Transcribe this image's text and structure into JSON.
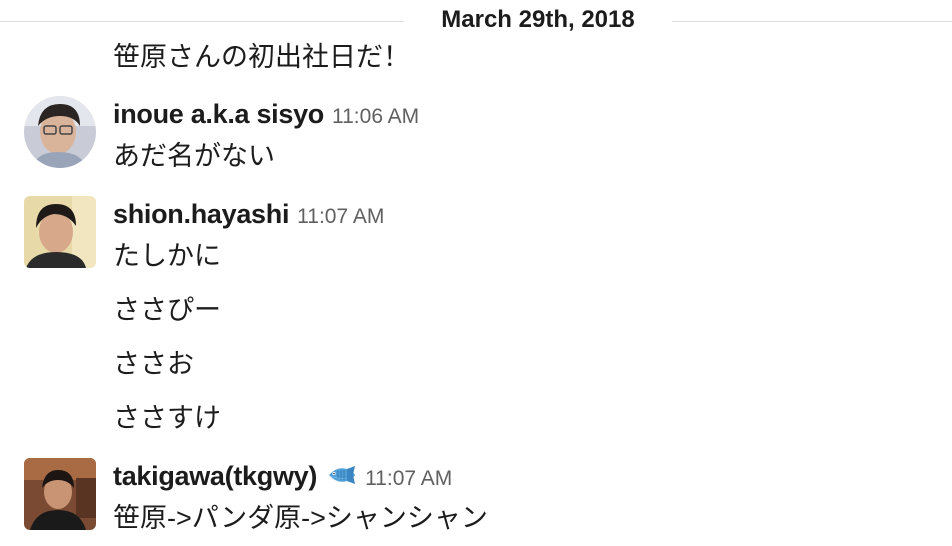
{
  "divider": {
    "date": "March 29th, 2018"
  },
  "messages": [
    {
      "username": "",
      "time": "",
      "lines": [
        "笹原さんの初出社日だ！"
      ]
    },
    {
      "username": "inoue a.k.a sisyo",
      "time": "11:06 AM",
      "avatar": "user-avatar-inoue",
      "lines": [
        "あだ名がない"
      ]
    },
    {
      "username": "shion.hayashi",
      "time": "11:07 AM",
      "avatar": "user-avatar-shion",
      "lines": [
        "たしかに",
        "ささぴー",
        "ささお",
        "ささすけ"
      ]
    },
    {
      "username": "takigawa(tkgwy)",
      "time": "11:07 AM",
      "status_emoji": "fish-icon",
      "avatar": "user-avatar-takigawa",
      "lines": [
        "笹原->パンダ原->シャンシャン"
      ]
    }
  ]
}
